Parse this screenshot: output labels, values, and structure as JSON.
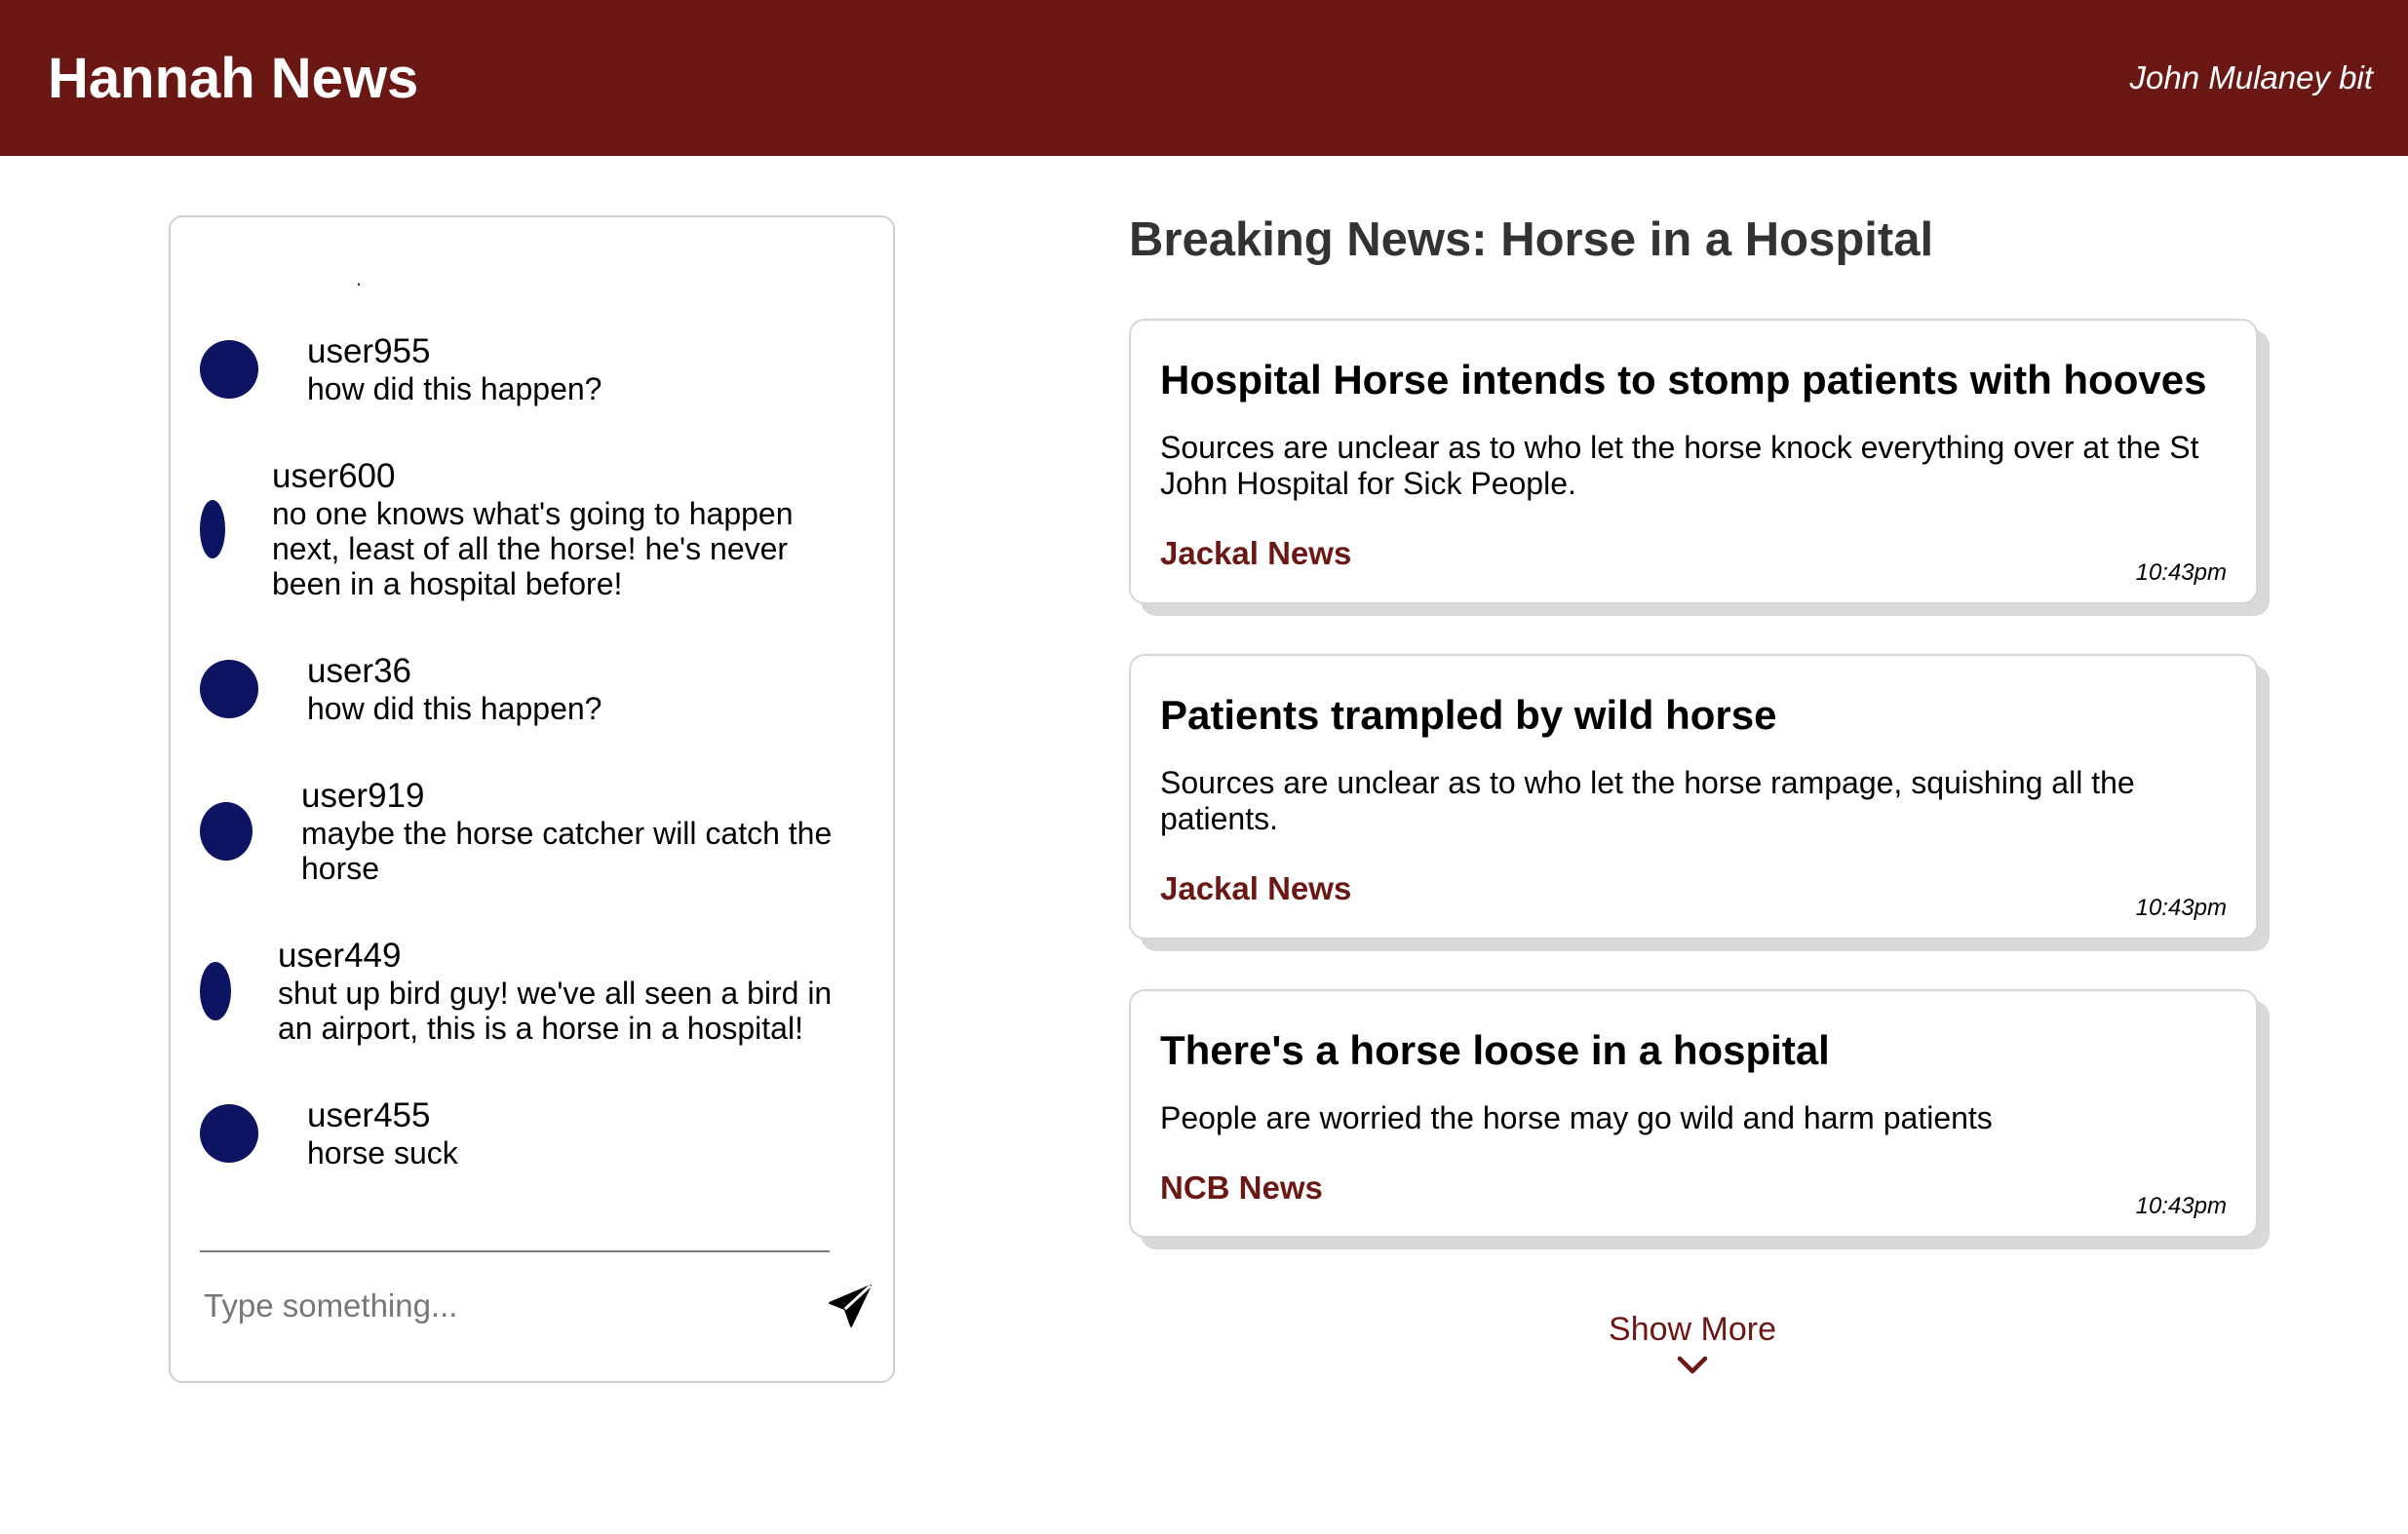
{
  "header": {
    "title": "Hannah News",
    "tagline": "John Mulaney bit"
  },
  "chat": {
    "top_fragment": ".",
    "messages": [
      {
        "user": "user955",
        "lines": [
          "how did this happen?"
        ]
      },
      {
        "user": "user600",
        "lines": [
          "no one knows what's going to happen",
          "next, least of all the horse! he's never",
          "been in a hospital before!"
        ]
      },
      {
        "user": "user36",
        "lines": [
          "how did this happen?"
        ]
      },
      {
        "user": "user919",
        "lines": [
          "maybe the horse catcher will catch the",
          "horse"
        ]
      },
      {
        "user": "user449",
        "lines": [
          "shut up bird guy! we've all seen a bird in",
          "an airport, this is a horse in a hospital!"
        ]
      },
      {
        "user": "user455",
        "lines": [
          "horse suck"
        ]
      }
    ],
    "input_placeholder": "Type something...",
    "avatar_color": "#0d1461"
  },
  "news": {
    "heading": "Breaking News: Horse in a Hospital",
    "cards": [
      {
        "title": "Hospital Horse intends to stomp patients with hooves",
        "desc_lines": [
          "Sources are unclear as to who let the horse knock everything over at the St",
          "John Hospital for Sick People."
        ],
        "source": "Jackal News",
        "time": "10:43pm"
      },
      {
        "title": "Patients trampled by wild horse",
        "desc_lines": [
          "Sources are unclear as to who let the horse rampage, squishing all the",
          "patients."
        ],
        "source": "Jackal News",
        "time": "10:43pm"
      },
      {
        "title": "There's a horse loose in a hospital",
        "desc_lines": [
          "People are worried the horse may go wild and harm patients"
        ],
        "source": "NCB News",
        "time": "10:43pm"
      }
    ],
    "show_more": "Show More"
  },
  "colors": {
    "brand": "#6b1815",
    "avatar": "#0d1461"
  }
}
